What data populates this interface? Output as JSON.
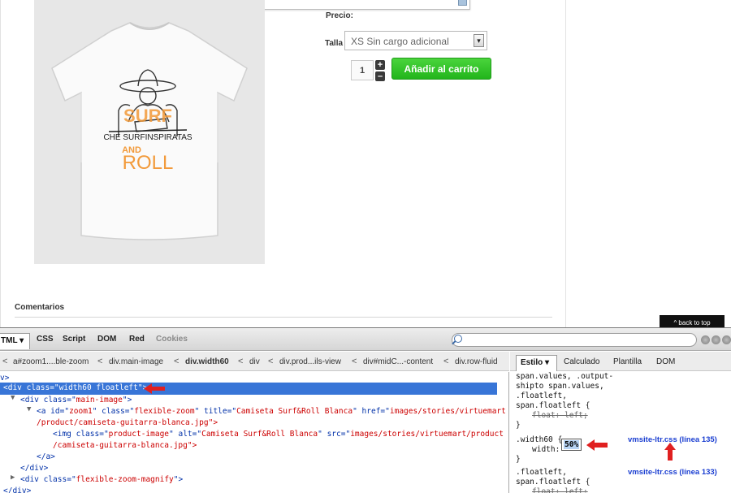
{
  "page": {
    "precio_label": "Precio:",
    "talla_label": "Talla",
    "talla_selected": "XS Sin cargo adicional",
    "quantity": "1",
    "plus": "+",
    "minus": "–",
    "add_to_cart": "Añadir al carrito",
    "comentarios": "Comentarios",
    "back_to_top": "^ back to top",
    "product_image": {
      "print_text_top": "SURF",
      "print_text_mid": "CHE SURFINSPIRATAS",
      "print_text_bottom": "ROLL",
      "accent_color": "#f29a3a"
    }
  },
  "devtools": {
    "tabs": [
      {
        "label": "TML ▾",
        "active": true
      },
      {
        "label": "CSS"
      },
      {
        "label": "Script"
      },
      {
        "label": "DOM"
      },
      {
        "label": "Red"
      },
      {
        "label": "Cookies",
        "disabled": true
      }
    ],
    "breadcrumbs": [
      "a#zoom1....ble-zoom",
      "div.main-image",
      "div.width60",
      "div",
      "div.prod...ils-view",
      "div#midC...-content",
      "div.row-fluid"
    ],
    "html_lines": {
      "l0": "v>",
      "l1": "<div class=\"width60 floatleft\">",
      "l2a": "<div ",
      "l2b": "class",
      "l2c": "=\"",
      "l2d": "main-image",
      "l2e": "\">",
      "l3a": "<a ",
      "l3b": "id",
      "l3c": "zoom1",
      "l3d": "class",
      "l3e": "flexible-zoom",
      "l3f": "title",
      "l3g": "Camiseta Surf&Roll Blanca",
      "l3h": "href",
      "l3i": "images/stories/virtuemart",
      "l4": "/product/camiseta-guitarra-blanca.jpg\">",
      "l5a": "<img ",
      "l5b": "class",
      "l5c": "product-image",
      "l5d": "alt",
      "l5e": "Camiseta Surf&Roll Blanca",
      "l5f": "src",
      "l5g": "images/stories/virtuemart/product",
      "l6": "/camiseta-guitarra-blanca.jpg\">",
      "l7": "</a>",
      "l8": "</div>",
      "l9a": "<div ",
      "l9b": "class",
      "l9c": "flexible-zoom-magnify",
      "l9d": "\">",
      "l10": "</div>"
    },
    "style_tabs": {
      "estilo": "Estilo ▾",
      "calculado": "Calculado",
      "plantilla": "Plantilla",
      "dom": "DOM"
    },
    "css_lines": {
      "c1": "span.values, .output-",
      "c2": "shipto span.values,",
      "c3": ".floatleft,",
      "c4": "span.floatleft {",
      "c5a": "float",
      "c5b": ": ",
      "c5c": "left",
      "c6": "}",
      "c7": ".width60 {",
      "c8a": "width: ",
      "c8b": "50%",
      "c9": "}",
      "c10": ".floatleft,",
      "c11": "span.floatleft {",
      "c12a": "float",
      "c12c": "left"
    },
    "css_links": {
      "link1": "vmsite-ltr.css (línea 135)",
      "link2": "vmsite-ltr.css (línea 133)"
    }
  },
  "colors": {
    "add_to_cart": "#2ec125",
    "selection": "#3875d7",
    "annotation_arrow": "#e02020"
  }
}
